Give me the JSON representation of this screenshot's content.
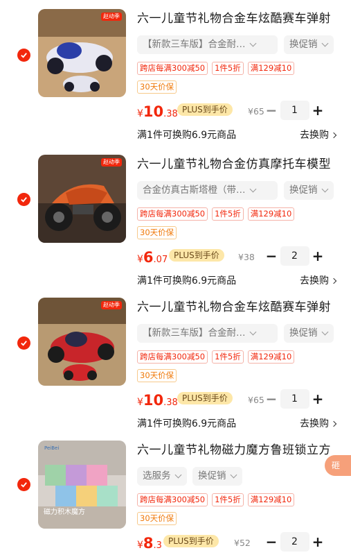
{
  "items": [
    {
      "title": "六一儿童节礼物合金车炫酷赛车弹射",
      "thumb_tag": "赵动季",
      "spec": "【新款三车版】合金耐…",
      "promo_select": "换促销",
      "promos": [
        "跨店每满300减50",
        "1件5折",
        "满129减10"
      ],
      "guarantee": "30天价保",
      "price_currency": "¥",
      "price_int": "10",
      "price_dec": ".38",
      "plus_label": "PLUS到手价",
      "orig_price": "¥65",
      "qty": "1",
      "exchange": "满1件可换购6.9元商品",
      "exchange_link": "去换购"
    },
    {
      "title": "六一儿童节礼物合金仿真摩托车模型",
      "thumb_tag": "赵动季",
      "spec": "合金仿真古斯塔橙（带…",
      "promo_select": "换促销",
      "promos": [
        "跨店每满300减50",
        "1件5折",
        "满129减10"
      ],
      "guarantee": "30天价保",
      "price_currency": "¥",
      "price_int": "6",
      "price_dec": ".07",
      "plus_label": "PLUS到手价",
      "orig_price": "¥38",
      "qty": "2",
      "exchange": "满1件可换购6.9元商品",
      "exchange_link": "去换购"
    },
    {
      "title": "六一儿童节礼物合金车炫酷赛车弹射",
      "thumb_tag": "赵动季",
      "spec": "【新款三车版】合金耐…",
      "promo_select": "换促销",
      "promos": [
        "跨店每满300减50",
        "1件5折",
        "满129减10"
      ],
      "guarantee": "30天价保",
      "price_currency": "¥",
      "price_int": "10",
      "price_dec": ".38",
      "plus_label": "PLUS到手价",
      "orig_price": "¥65",
      "qty": "1",
      "exchange": "满1件可换购6.9元商品",
      "exchange_link": "去换购"
    },
    {
      "title": "六一儿童节礼物磁力魔方鲁班锁立方",
      "thumb_tag": "PeiBei",
      "thumb_caption": "磁力积木魔方",
      "spec": "选服务",
      "promo_select": "换促销",
      "promos": [
        "跨店每满300减50",
        "1件5折",
        "满129减10"
      ],
      "guarantee": "30天价保",
      "price_currency": "¥",
      "price_int": "8",
      "price_dec": ".3",
      "plus_label": "PLUS到手价",
      "orig_price": "¥52",
      "qty": "2",
      "corner_badge": "砸"
    }
  ],
  "colors": {
    "accent_red": "#f2270c",
    "plus_bg": "#fde7a8",
    "guarantee_orange": "#f07a0a"
  }
}
